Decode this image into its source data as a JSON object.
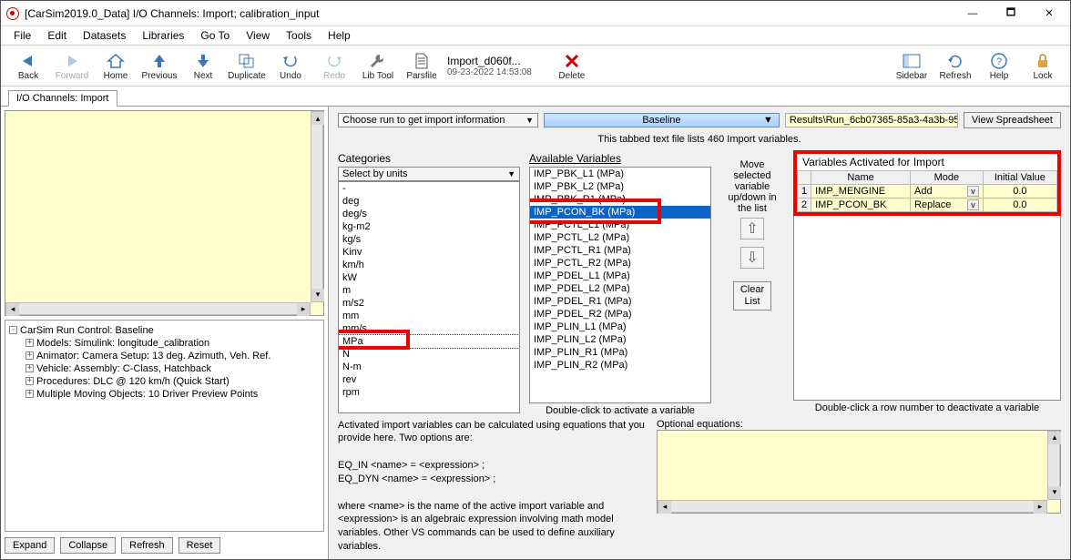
{
  "window": {
    "title": "[CarSim2019.0_Data] I/O Channels: Import; calibration_input",
    "min": "—",
    "max": "🗖",
    "close": "✕"
  },
  "menu": [
    "File",
    "Edit",
    "Datasets",
    "Libraries",
    "Go To",
    "View",
    "Tools",
    "Help"
  ],
  "toolbar": {
    "back": "Back",
    "forward": "Forward",
    "home": "Home",
    "previous": "Previous",
    "next": "Next",
    "duplicate": "Duplicate",
    "undo": "Undo",
    "redo": "Redo",
    "libtool": "Lib Tool",
    "parsfile": "Parsfile",
    "parsfile_name": "Import_d060f...",
    "parsfile_date": "09-23-2022 14:53:08",
    "delete": "Delete",
    "sidebar": "Sidebar",
    "refresh": "Refresh",
    "help": "Help",
    "lock": "Lock"
  },
  "tab_label": "I/O Channels: Import",
  "tree": {
    "root": "CarSim Run Control: Baseline",
    "children": [
      "Models: Simulink: longitude_calibration",
      "Animator: Camera Setup: 13 deg. Azimuth, Veh. Ref.",
      "Vehicle: Assembly: C-Class, Hatchback",
      "Procedures: DLC @ 120 km/h (Quick Start)",
      "Multiple Moving Objects: 10 Driver Preview Points"
    ]
  },
  "btns": {
    "expand": "Expand",
    "collapse": "Collapse",
    "refresh": "Refresh",
    "reset": "Reset"
  },
  "top": {
    "choose_run": "Choose run to get import information",
    "baseline": "Baseline",
    "result": "Results\\Run_6cb07365-85a3-4a3b-95",
    "view_spreadsheet": "View Spreadsheet",
    "tabbed_info": "This tabbed text file lists 460 Import variables."
  },
  "categories": {
    "title": "Categories",
    "select_by_units": "Select by units",
    "items": [
      "-",
      "deg",
      "deg/s",
      "kg-m2",
      "kg/s",
      "Kinv",
      "km/h",
      "kW",
      "m",
      "m/s2",
      "mm",
      "mm/s",
      "MPa",
      "N",
      "N-m",
      "rev",
      "rpm"
    ],
    "highlight": "MPa"
  },
  "available": {
    "title": "Available Variables",
    "items": [
      "IMP_PBK_L1 (MPa)",
      "IMP_PBK_L2 (MPa)",
      "IMP_PBK_R1 (MPa)",
      "IMP_PCON_BK (MPa)",
      "IMP_PCTL_L1 (MPa)",
      "IMP_PCTL_L2 (MPa)",
      "IMP_PCTL_R1 (MPa)",
      "IMP_PCTL_R2 (MPa)",
      "IMP_PDEL_L1 (MPa)",
      "IMP_PDEL_L2 (MPa)",
      "IMP_PDEL_R1 (MPa)",
      "IMP_PDEL_R2 (MPa)",
      "IMP_PLIN_L1 (MPa)",
      "IMP_PLIN_L2 (MPa)",
      "IMP_PLIN_R1 (MPa)",
      "IMP_PLIN_R2 (MPa)"
    ],
    "selected": "IMP_PCON_BK (MPa)",
    "hint": "Double-click to activate a variable"
  },
  "mid": {
    "move_text": "Move selected variable up/down in the list",
    "clear": "Clear List"
  },
  "activated": {
    "title": "Variables Activated for Import",
    "cols": {
      "name": "Name",
      "mode": "Mode",
      "initval": "Initial Value"
    },
    "rows": [
      {
        "n": "1",
        "name": "IMP_MENGINE",
        "mode": "Add",
        "val": "0.0"
      },
      {
        "n": "2",
        "name": "IMP_PCON_BK",
        "mode": "Replace",
        "val": "0.0"
      }
    ],
    "hint": "Double-click a row number to deactivate a variable"
  },
  "equations": {
    "intro": "Activated import variables can be calculated using equations that you provide here. Two options are:",
    "line1": "EQ_IN <name> = <expression> ;",
    "line2": "EQ_DYN <name> = <expression> ;",
    "explain": "where <name> is the name of the active import variable and <expression> is an algebraic expression involving math model variables. Other VS commands can be used to define auxiliary variables.",
    "optional_label": "Optional equations:"
  }
}
